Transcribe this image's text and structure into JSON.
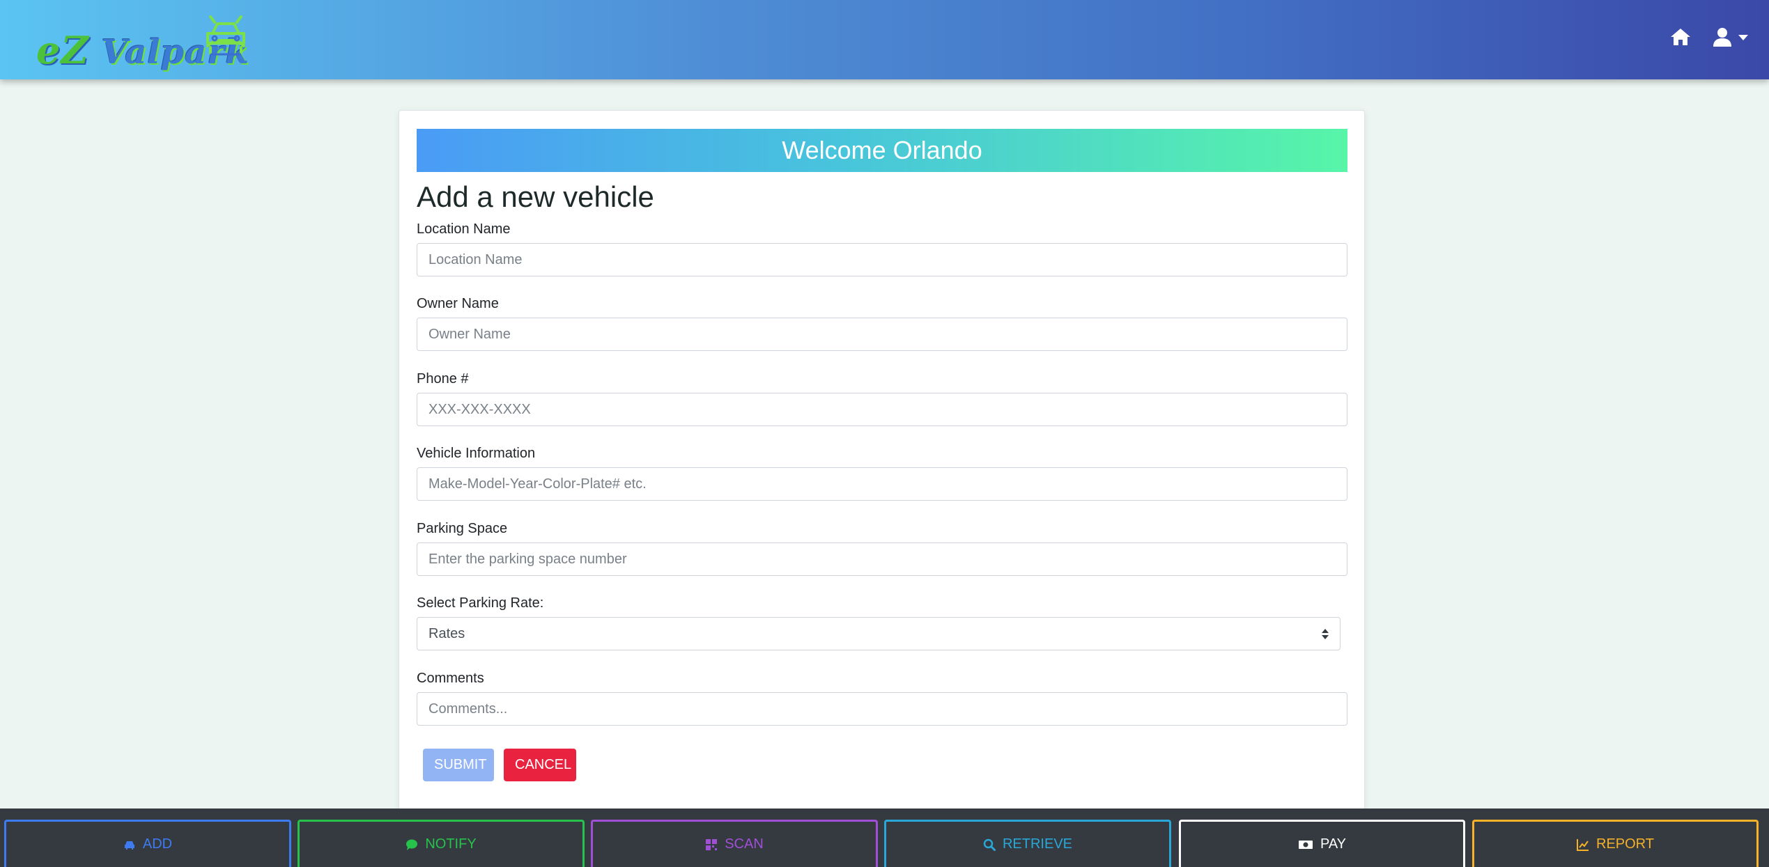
{
  "header": {
    "brand_prefix": "eZ",
    "brand_name": " Valpark"
  },
  "card": {
    "welcome": "Welcome Orlando",
    "title": "Add a new vehicle"
  },
  "form": {
    "location": {
      "label": "Location Name",
      "placeholder": "Location Name",
      "value": ""
    },
    "owner": {
      "label": "Owner Name",
      "placeholder": "Owner Name",
      "value": ""
    },
    "phone": {
      "label": "Phone #",
      "placeholder": "XXX-XXX-XXXX",
      "value": ""
    },
    "vehicle": {
      "label": "Vehicle Information",
      "placeholder": "Make-Model-Year-Color-Plate# etc.",
      "value": ""
    },
    "space": {
      "label": "Parking Space",
      "placeholder": "Enter the parking space number",
      "value": ""
    },
    "rate": {
      "label": "Select Parking Rate:",
      "selected": "Rates"
    },
    "comments": {
      "label": "Comments",
      "placeholder": "Comments...",
      "value": ""
    },
    "submit_label": "SUBMIT",
    "cancel_label": "CANCEL"
  },
  "bottom_nav": {
    "add": {
      "label": "ADD",
      "icon": "car-icon",
      "color": "#3f7bf0"
    },
    "notify": {
      "label": "NOTIFY",
      "icon": "chat-icon",
      "color": "#27c24c"
    },
    "scan": {
      "label": "SCAN",
      "icon": "qrcode-icon",
      "color": "#a04fd6"
    },
    "retrieve": {
      "label": "RETRIEVE",
      "icon": "search-icon",
      "color": "#2aa7d9"
    },
    "pay": {
      "label": "PAY",
      "icon": "money-icon",
      "color": "#ffffff"
    },
    "report": {
      "label": "REPORT",
      "icon": "chart-icon",
      "color": "#f5b228"
    }
  },
  "colors": {
    "page_bg": "#edf5f2",
    "submit": "#93b4f4",
    "cancel": "#e8223f"
  }
}
